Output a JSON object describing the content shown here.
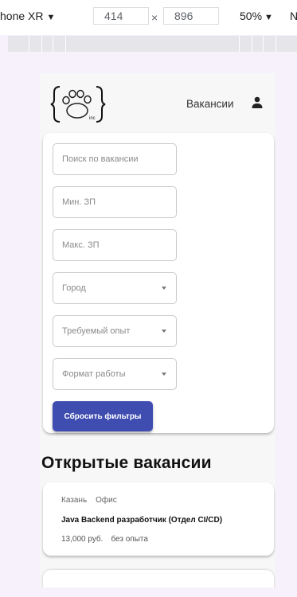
{
  "devtools": {
    "device": "hone XR",
    "device_caret": "▼",
    "width": "414",
    "times": "×",
    "height": "896",
    "zoom": "50%",
    "zoom_caret": "▼",
    "next_fragment": "N"
  },
  "header": {
    "nav_vacancies": "Вакансии",
    "logo_suffix": "inc"
  },
  "filters": {
    "search_placeholder": "Поиск по вакансии",
    "min_salary_placeholder": "Мин. ЗП",
    "max_salary_placeholder": "Макс. ЗП",
    "city_select": "Город",
    "experience_select": "Требуемый опыт",
    "work_format_select": "Формат работы",
    "reset_button": "Сбросить фильтры"
  },
  "vacancies": {
    "title": "Открытые вакансии",
    "items": [
      {
        "city": "Казань",
        "format": "Офис",
        "title": "Java Backend разработчик (Отдел CI/CD)",
        "salary": "13,000 руб.",
        "experience": "без опыта"
      }
    ]
  }
}
